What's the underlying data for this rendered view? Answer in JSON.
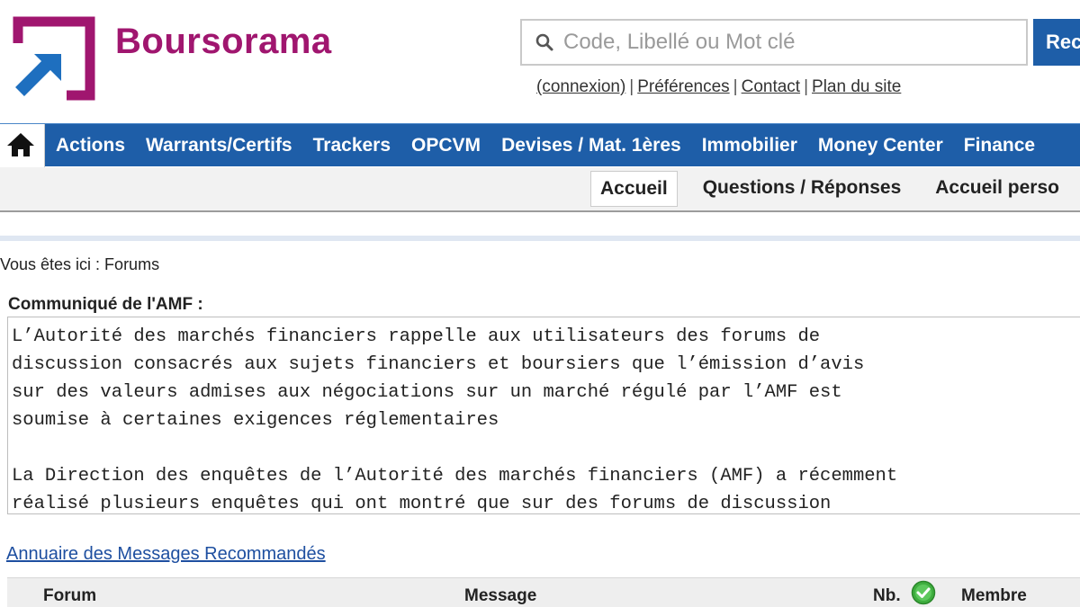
{
  "brand": {
    "name": "Boursorama",
    "color": "#a0166f",
    "accent_blue": "#1e5ea8"
  },
  "search": {
    "placeholder": "Code, Libellé ou Mot clé",
    "button_label": "Rechercher"
  },
  "top_links": [
    {
      "label": "(connexion)"
    },
    {
      "label": "Préférences"
    },
    {
      "label": "Contact"
    },
    {
      "label": "Plan du site"
    }
  ],
  "main_nav": {
    "home_icon": "home-icon",
    "items": [
      {
        "label": "Actions"
      },
      {
        "label": "Warrants/Certifs"
      },
      {
        "label": "Trackers"
      },
      {
        "label": "OPCVM"
      },
      {
        "label": "Devises / Mat. 1ères"
      },
      {
        "label": "Immobilier"
      },
      {
        "label": "Money Center"
      },
      {
        "label": "Finance"
      }
    ]
  },
  "sub_nav": {
    "items": [
      {
        "label": "Accueil",
        "active": true
      },
      {
        "label": "Questions / Réponses"
      },
      {
        "label": "Accueil perso"
      }
    ]
  },
  "breadcrumb": "Vous êtes ici : Forums",
  "amf": {
    "title": "Communiqué de l'AMF :",
    "lines": [
      "L’Autorité des marchés financiers rappelle aux utilisateurs des forums de",
      "discussion consacrés aux sujets financiers et boursiers que l’émission d’avis",
      "sur des valeurs admises aux négociations sur un marché régulé par l’AMF est",
      "soumise à certaines exigences réglementaires",
      "",
      "La Direction des enquêtes de l’Autorité des marchés financiers (AMF) a récemment",
      "réalisé plusieurs enquêtes qui ont montré que sur des forums de discussion"
    ]
  },
  "annuaire_link": "Annuaire des Messages Recommandés",
  "table": {
    "headers": {
      "forum": "Forum",
      "message": "Message",
      "nb": "Nb.",
      "membre": "Membre"
    },
    "check_icon": "check-icon"
  }
}
